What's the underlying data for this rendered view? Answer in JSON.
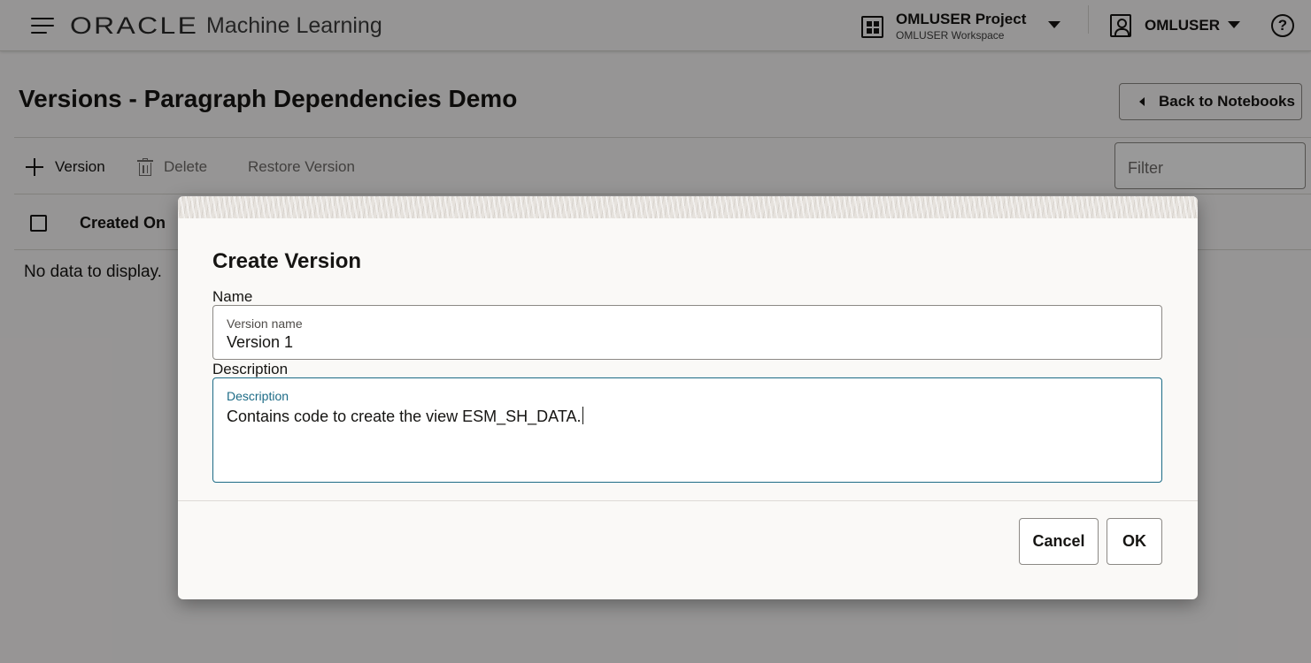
{
  "header": {
    "brand_oracle": "ORACLE",
    "brand_product": "Machine Learning",
    "project_name": "OMLUSER Project",
    "workspace_name": "OMLUSER Workspace",
    "user_name": "OMLUSER",
    "help_glyph": "?",
    "icons": {
      "menu": "hamburger-icon",
      "project": "grid-icon",
      "user": "user-icon",
      "help": "help-icon"
    }
  },
  "page": {
    "title": "Versions - Paragraph Dependencies Demo",
    "back_button": "Back to Notebooks"
  },
  "toolbar": {
    "add_label": "Version",
    "delete_label": "Delete",
    "restore_label": "Restore Version",
    "filter_placeholder": "Filter"
  },
  "table": {
    "columns": [
      "Created On"
    ],
    "empty_message": "No data to display."
  },
  "dialog": {
    "title": "Create Version",
    "name_section_label": "Name",
    "name_field_label": "Version name",
    "name_value": "Version 1",
    "description_section_label": "Description",
    "description_field_label": "Description",
    "description_value": "Contains code to create the view ESM_SH_DATA.",
    "cancel_label": "Cancel",
    "ok_label": "OK"
  },
  "colors": {
    "background": "#fbf9f8",
    "text": "#161513",
    "focus_accent": "#1c6b86",
    "overlay": "rgba(0,0,0,0.40)"
  }
}
